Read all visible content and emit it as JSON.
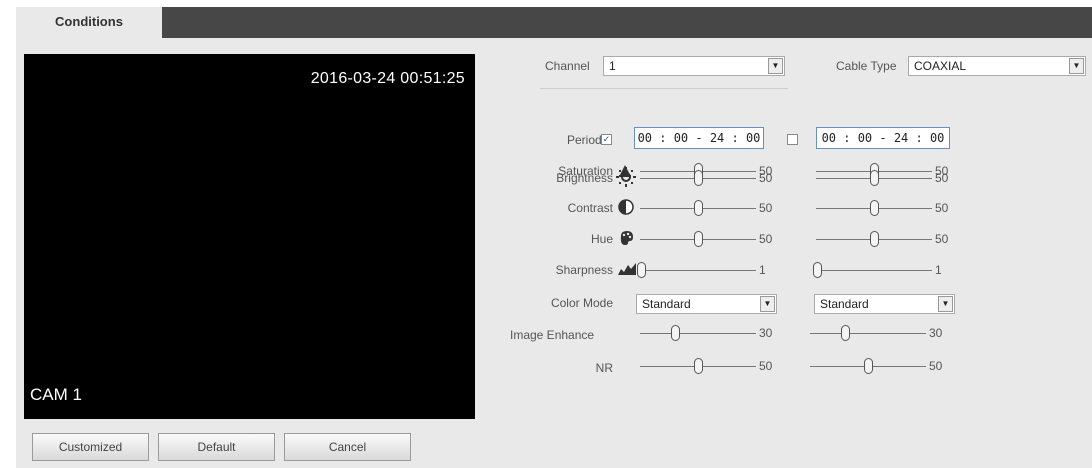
{
  "tab": {
    "label": "Conditions"
  },
  "preview": {
    "timestamp": "2016-03-24 00:51:25",
    "camera": "CAM 1"
  },
  "channel": {
    "label": "Channel",
    "value": "1"
  },
  "cable_type": {
    "label": "Cable Type",
    "value": "COAXIAL"
  },
  "period": {
    "label": "Period",
    "p1": {
      "checked": true,
      "value": "00 : 00 - 24 : 00"
    },
    "p2": {
      "checked": false,
      "value": "00 : 00 - 24 : 00"
    }
  },
  "sliders": [
    {
      "label": "Saturation",
      "icon": "saturation-icon",
      "v1": 50,
      "v2": 50
    },
    {
      "label": "Brightness",
      "icon": "brightness-icon",
      "v1": 50,
      "v2": 50
    },
    {
      "label": "Contrast",
      "icon": "contrast-icon",
      "v1": 50,
      "v2": 50
    },
    {
      "label": "Hue",
      "icon": "hue-icon",
      "v1": 50,
      "v2": 50
    },
    {
      "label": "Sharpness",
      "icon": "sharpness-icon",
      "v1": 1,
      "v2": 1
    }
  ],
  "color_mode": {
    "label": "Color Mode",
    "v1": "Standard",
    "v2": "Standard"
  },
  "image_enhance": {
    "label": "Image Enhance",
    "v1": 30,
    "v2": 30
  },
  "nr": {
    "label": "NR",
    "v1": 50,
    "v2": 50
  },
  "buttons": {
    "customized": "Customized",
    "default": "Default",
    "cancel": "Cancel"
  },
  "colors": {
    "tabbar": "#474747",
    "panel": "#e9e9e9",
    "timebox_border": "#6b8fb9"
  }
}
